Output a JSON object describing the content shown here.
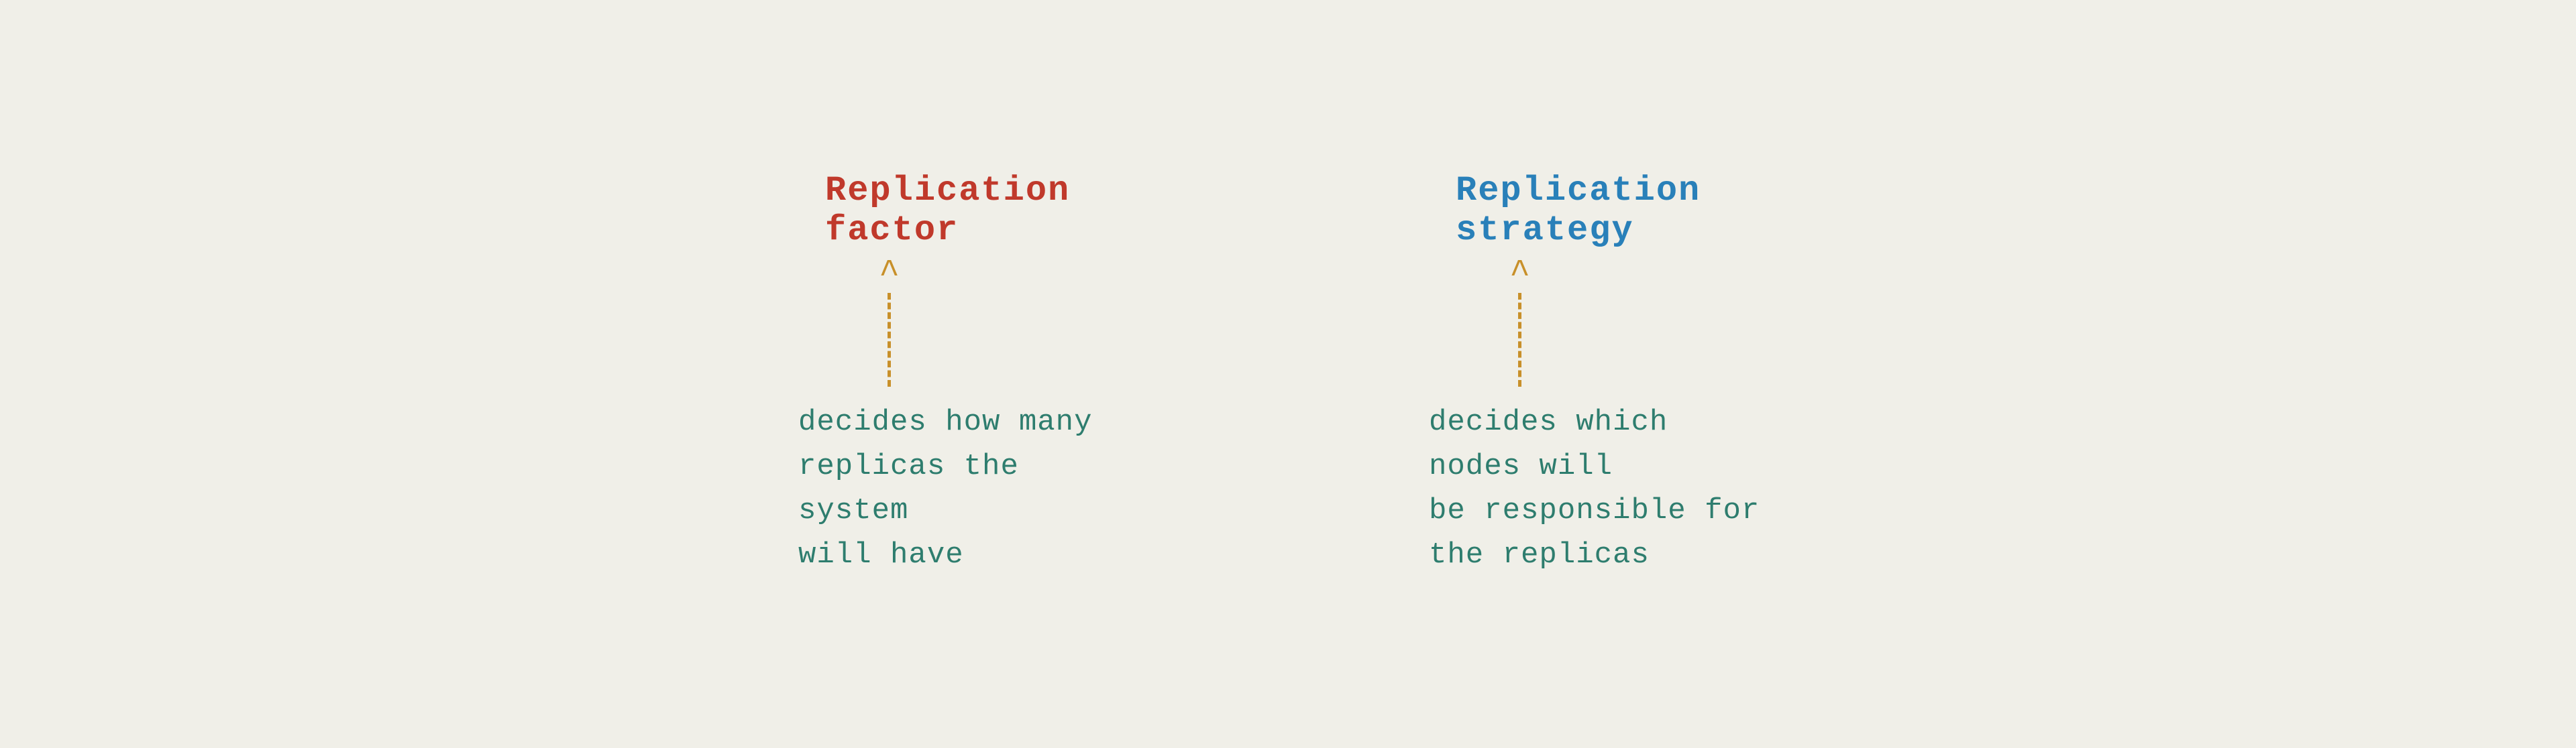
{
  "background_color": "#f0efe8",
  "left_item": {
    "title": "Replication factor",
    "title_color": "#c0392b",
    "title_class": "title-red",
    "caret": "^",
    "caret_color": "#c8902a",
    "dashed_line_color": "#c8902a",
    "description_line1": "decides how many",
    "description_line2": "replicas the system",
    "description_line3": "will have",
    "description_color": "#2e7d6e"
  },
  "right_item": {
    "title": "Replication strategy",
    "title_color": "#2980b9",
    "title_class": "title-blue",
    "caret": "^",
    "caret_color": "#c8902a",
    "dashed_line_color": "#c8902a",
    "description_line1": "decides which nodes will",
    "description_line2": "be responsible for",
    "description_line3": "the replicas",
    "description_color": "#2e7d6e"
  }
}
